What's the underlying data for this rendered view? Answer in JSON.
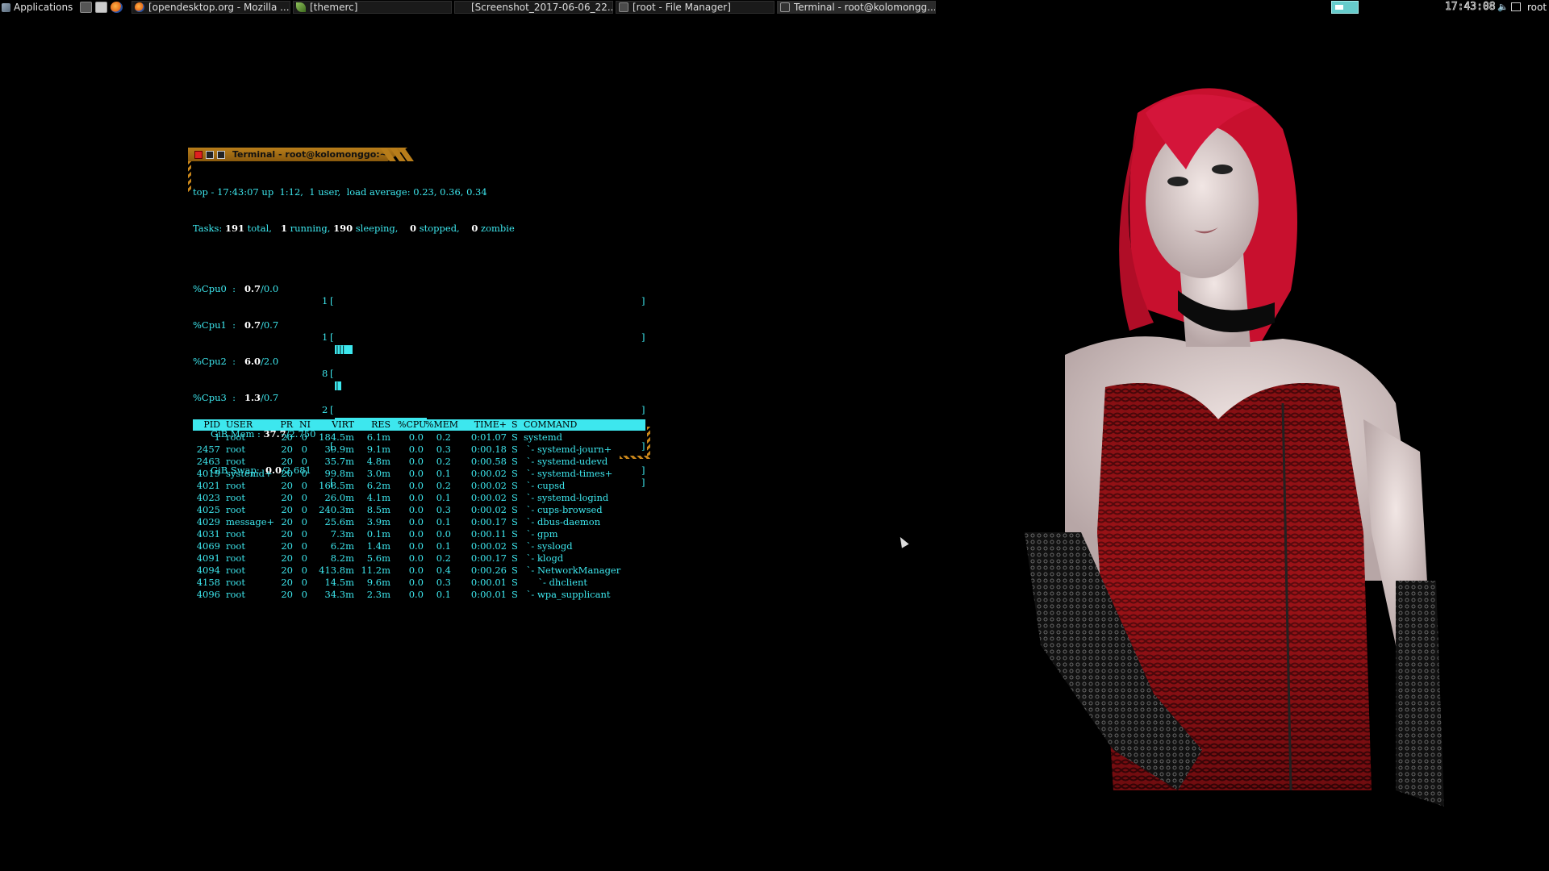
{
  "panel": {
    "applications_label": "Applications",
    "launchers": [
      "terminal-icon",
      "file-manager-icon",
      "firefox-icon"
    ],
    "tasks": [
      {
        "label": "[opendesktop.org - Mozilla ...",
        "icon": "firefox-icon"
      },
      {
        "label": "[themerc]",
        "icon": "editor-icon"
      },
      {
        "label": "[Screenshot_2017-06-06_22...",
        "icon": "screenshot-icon"
      },
      {
        "label": "[root - File Manager]",
        "icon": "file-manager-icon"
      },
      {
        "label": "Terminal - root@kolomongg...",
        "icon": "terminal-icon"
      }
    ],
    "clock": "17:43:08",
    "user": "root"
  },
  "terminal": {
    "title": "Terminal - root@kolomonggo:~",
    "top": {
      "uptime_line": "top - 17:43:07 up  1:12,  1 user,  load average: 0.23, 0.36, 0.34",
      "tasks_label": "Tasks:",
      "tasks_total": "191",
      "tasks_total_label": "total,",
      "tasks_running": "1",
      "tasks_running_label": "running,",
      "tasks_sleeping": "190",
      "tasks_sleeping_label": "sleeping,",
      "tasks_stopped": "0",
      "tasks_stopped_label": "stopped,",
      "tasks_zombie": "0",
      "tasks_zombie_label": "zombie",
      "cpus": [
        {
          "label": "%Cpu0  :",
          "value": "0.7",
          "rest": "/0.0",
          "n": "1",
          "ticks": ""
        },
        {
          "label": "%Cpu1  :",
          "value": "0.7",
          "rest": "/0.7",
          "n": "1",
          "ticks": ""
        },
        {
          "label": "%Cpu2  :",
          "value": "6.0",
          "rest": "/2.0",
          "n": "8",
          "ticks": "|||"
        },
        {
          "label": "%Cpu3  :",
          "value": "1.3",
          "rest": "/0.7",
          "n": "2",
          "ticks": "|"
        }
      ],
      "mem": {
        "label": "GiB Mem :",
        "value": "37.7",
        "rest": "/2.750",
        "fraction": 0.3
      },
      "swap": {
        "label": "GiB Swap:",
        "value": "0.0",
        "rest": "/2.681"
      },
      "columns": [
        "PID",
        "USER",
        "PR",
        "NI",
        "VIRT",
        "RES",
        "%CPU",
        "%MEM",
        "TIME+",
        "S",
        "COMMAND"
      ],
      "processes": [
        {
          "pid": "1",
          "user": "root",
          "pr": "20",
          "ni": "0",
          "virt": "184.5m",
          "res": "6.1m",
          "cpu": "0.0",
          "mem": "0.2",
          "time": "0:01.07",
          "s": "S",
          "cmd": "systemd"
        },
        {
          "pid": "2457",
          "user": "root",
          "pr": "20",
          "ni": "0",
          "virt": "39.9m",
          "res": "9.1m",
          "cpu": "0.0",
          "mem": "0.3",
          "time": "0:00.18",
          "s": "S",
          "cmd": " `- systemd-journ+"
        },
        {
          "pid": "2463",
          "user": "root",
          "pr": "20",
          "ni": "0",
          "virt": "35.7m",
          "res": "4.8m",
          "cpu": "0.0",
          "mem": "0.2",
          "time": "0:00.58",
          "s": "S",
          "cmd": " `- systemd-udevd"
        },
        {
          "pid": "4019",
          "user": "systemd+",
          "pr": "20",
          "ni": "0",
          "virt": "99.8m",
          "res": "3.0m",
          "cpu": "0.0",
          "mem": "0.1",
          "time": "0:00.02",
          "s": "S",
          "cmd": " `- systemd-times+"
        },
        {
          "pid": "4021",
          "user": "root",
          "pr": "20",
          "ni": "0",
          "virt": "168.5m",
          "res": "6.2m",
          "cpu": "0.0",
          "mem": "0.2",
          "time": "0:00.02",
          "s": "S",
          "cmd": " `- cupsd"
        },
        {
          "pid": "4023",
          "user": "root",
          "pr": "20",
          "ni": "0",
          "virt": "26.0m",
          "res": "4.1m",
          "cpu": "0.0",
          "mem": "0.1",
          "time": "0:00.02",
          "s": "S",
          "cmd": " `- systemd-logind"
        },
        {
          "pid": "4025",
          "user": "root",
          "pr": "20",
          "ni": "0",
          "virt": "240.3m",
          "res": "8.5m",
          "cpu": "0.0",
          "mem": "0.3",
          "time": "0:00.02",
          "s": "S",
          "cmd": " `- cups-browsed"
        },
        {
          "pid": "4029",
          "user": "message+",
          "pr": "20",
          "ni": "0",
          "virt": "25.6m",
          "res": "3.9m",
          "cpu": "0.0",
          "mem": "0.1",
          "time": "0:00.17",
          "s": "S",
          "cmd": " `- dbus-daemon"
        },
        {
          "pid": "4031",
          "user": "root",
          "pr": "20",
          "ni": "0",
          "virt": "7.3m",
          "res": "0.1m",
          "cpu": "0.0",
          "mem": "0.0",
          "time": "0:00.11",
          "s": "S",
          "cmd": " `- gpm"
        },
        {
          "pid": "4069",
          "user": "root",
          "pr": "20",
          "ni": "0",
          "virt": "6.2m",
          "res": "1.4m",
          "cpu": "0.0",
          "mem": "0.1",
          "time": "0:00.02",
          "s": "S",
          "cmd": " `- syslogd"
        },
        {
          "pid": "4091",
          "user": "root",
          "pr": "20",
          "ni": "0",
          "virt": "8.2m",
          "res": "5.6m",
          "cpu": "0.0",
          "mem": "0.2",
          "time": "0:00.17",
          "s": "S",
          "cmd": " `- klogd"
        },
        {
          "pid": "4094",
          "user": "root",
          "pr": "20",
          "ni": "0",
          "virt": "413.8m",
          "res": "11.2m",
          "cpu": "0.0",
          "mem": "0.4",
          "time": "0:00.26",
          "s": "S",
          "cmd": " `- NetworkManager"
        },
        {
          "pid": "4158",
          "user": "root",
          "pr": "20",
          "ni": "0",
          "virt": "14.5m",
          "res": "9.6m",
          "cpu": "0.0",
          "mem": "0.3",
          "time": "0:00.01",
          "s": "S",
          "cmd": "     `- dhclient"
        },
        {
          "pid": "4096",
          "user": "root",
          "pr": "20",
          "ni": "0",
          "virt": "34.3m",
          "res": "2.3m",
          "cpu": "0.0",
          "mem": "0.1",
          "time": "0:00.01",
          "s": "S",
          "cmd": " `- wpa_supplicant"
        }
      ]
    }
  },
  "colors": {
    "terminal_text": "#3de7ee",
    "frame_accent": "#b87d1a",
    "close_button": "#e02020",
    "wallpaper_hair": "#c8102e"
  }
}
